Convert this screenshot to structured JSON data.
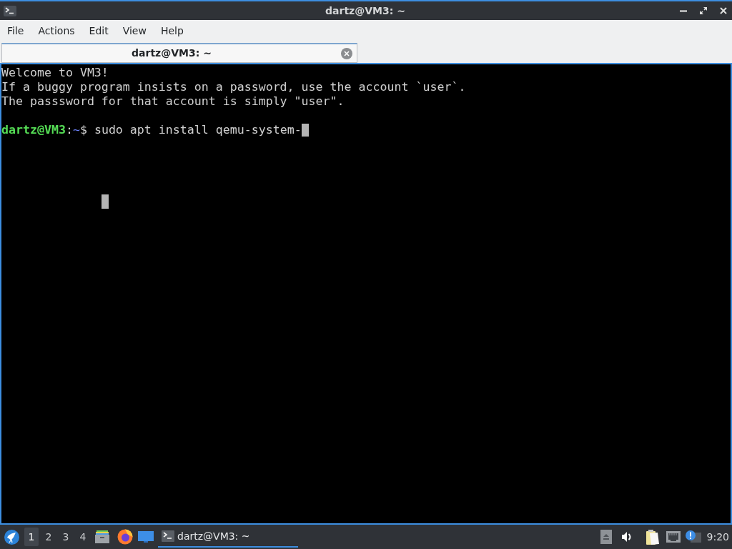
{
  "window": {
    "title": "dartz@VM3: ~"
  },
  "menu_bar": [
    "File",
    "Actions",
    "Edit",
    "View",
    "Help"
  ],
  "tabs": [
    {
      "label": "dartz@VM3: ~",
      "selected": true
    }
  ],
  "terminal": {
    "output": [
      "Welcome to VM3!",
      "If a buggy program insists on a password, use the account `user`.",
      "The passsword for that account is simply \"user\"."
    ],
    "prompt": {
      "user_host": "dartz@VM3",
      "separator": ":",
      "path": "~",
      "symbol": "$"
    },
    "command": "sudo apt install qemu-system-"
  },
  "taskbar": {
    "desktops": [
      {
        "label": "1",
        "selected": true
      },
      {
        "label": "2",
        "selected": false
      },
      {
        "label": "3",
        "selected": false
      },
      {
        "label": "4",
        "selected": false
      }
    ],
    "tasks": [
      {
        "label": "dartz@VM3: ~",
        "selected": true
      }
    ],
    "clock": "9:20"
  }
}
